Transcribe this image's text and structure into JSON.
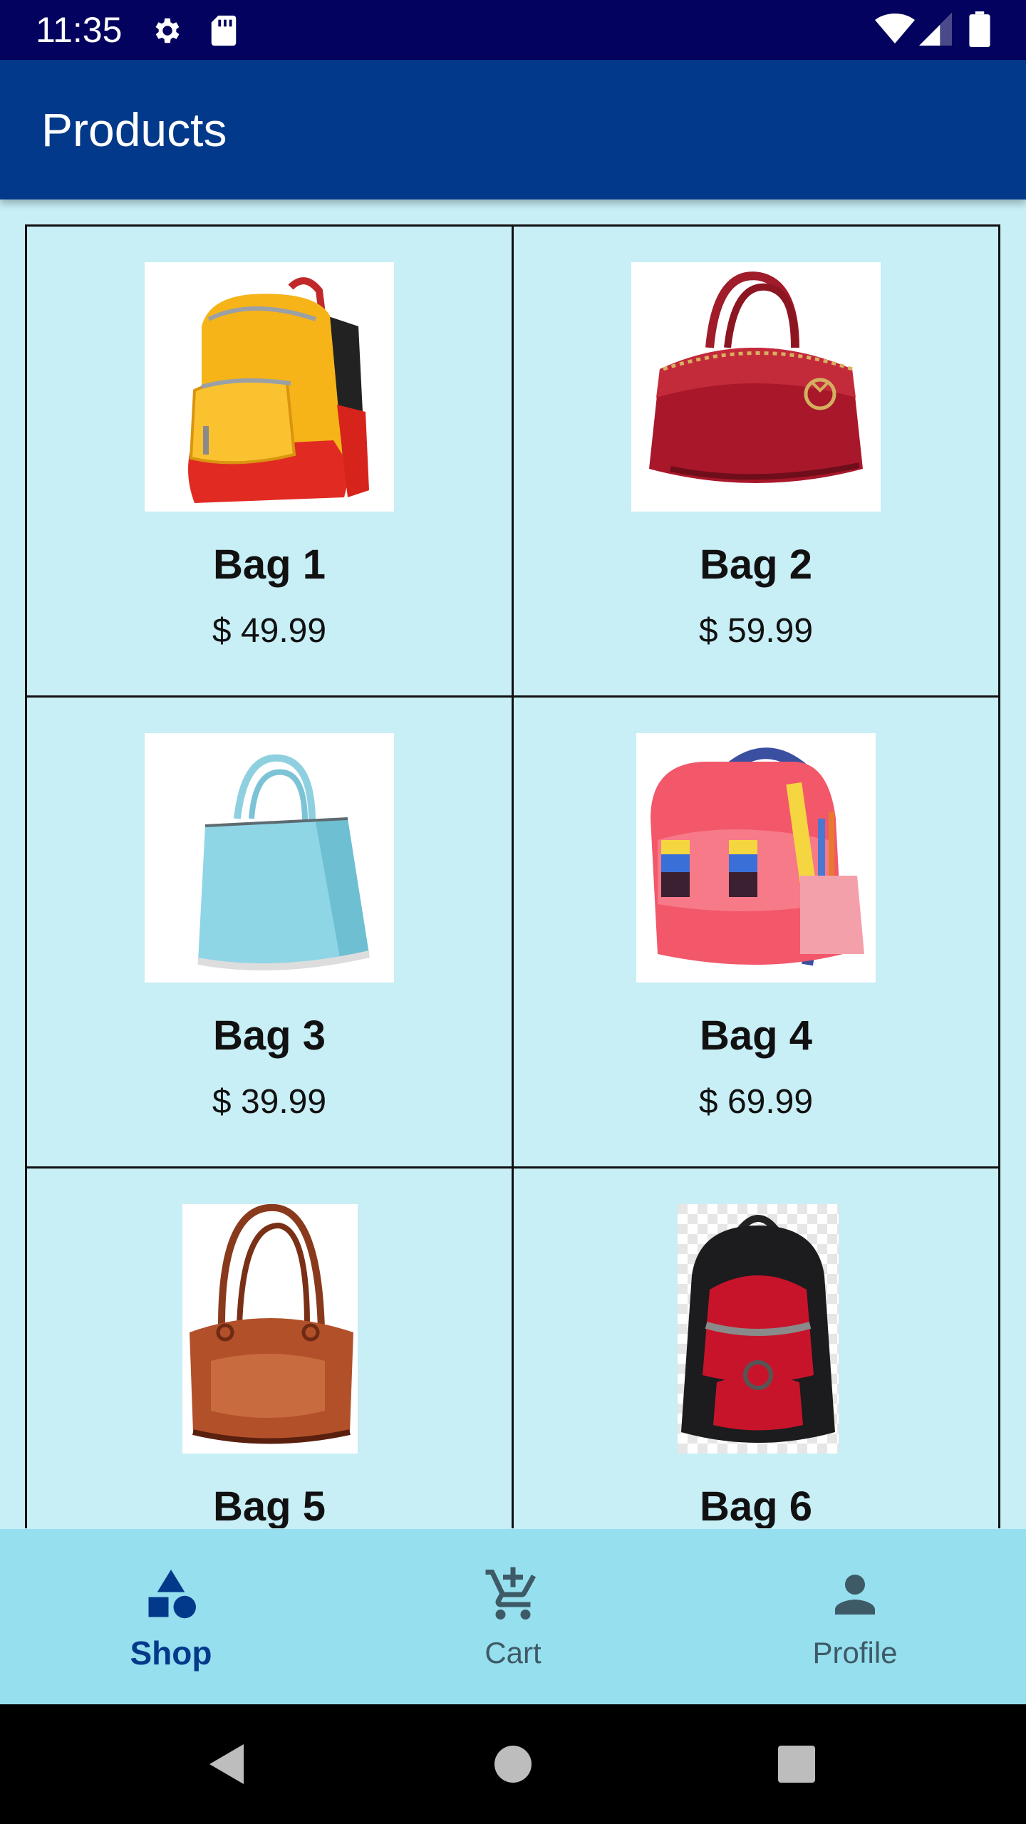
{
  "status_bar": {
    "time": "11:35",
    "icons": [
      "gear-icon",
      "sd-card-icon",
      "wifi-icon",
      "signal-icon",
      "battery-icon"
    ],
    "background": "#03035f"
  },
  "app_bar": {
    "title": "Products",
    "background": "#03398a"
  },
  "products": [
    {
      "name": "Bag 1",
      "price": "$ 49.99",
      "image": "yellow-red-backpack"
    },
    {
      "name": "Bag 2",
      "price": "$ 59.99",
      "image": "red-leather-handbag"
    },
    {
      "name": "Bag 3",
      "price": "$ 39.99",
      "image": "light-blue-tote"
    },
    {
      "name": "Bag 4",
      "price": "$ 69.99",
      "image": "pink-school-backpack"
    },
    {
      "name": "Bag 5",
      "price": "",
      "image": "brown-doctor-bag"
    },
    {
      "name": "Bag 6",
      "price": "",
      "image": "black-red-backpack"
    }
  ],
  "bottom_nav": {
    "items": [
      {
        "label": "Shop",
        "icon": "shapes-icon",
        "active": true
      },
      {
        "label": "Cart",
        "icon": "cart-add-icon",
        "active": false
      },
      {
        "label": "Profile",
        "icon": "person-icon",
        "active": false
      }
    ],
    "background": "#95dfee",
    "active_color": "#03398a"
  },
  "system_nav": {
    "icons": [
      "back-icon",
      "home-icon",
      "recents-icon"
    ]
  },
  "colors": {
    "grid_background": "#c8eef6",
    "card_border": "#111111"
  }
}
